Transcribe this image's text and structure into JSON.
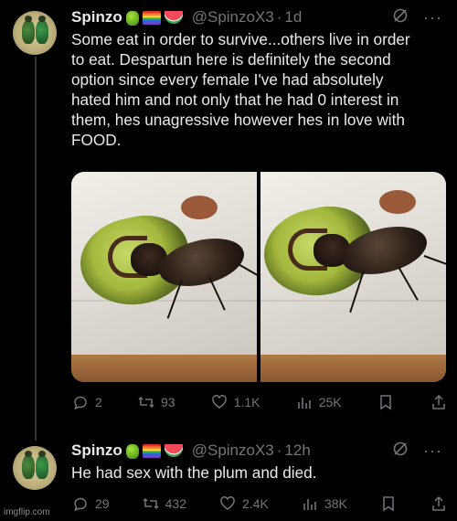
{
  "tweets": [
    {
      "name": "Spinzo",
      "emojis": [
        "beetle-emoji",
        "rainbow-flag-emoji",
        "watermelon-emoji"
      ],
      "handle": "@SpinzoX3",
      "separator": "·",
      "time": "1d",
      "text": "Some eat in order to survive...others live in order\nto eat. Despartun here is definitely the second\noption since every female I've had absolutely\nhated him and not only that he had 0 interest in\nthem, hes unagressive however hes in love with\nFOOD.",
      "stats": {
        "replies": "2",
        "reposts": "93",
        "likes": "1.1K",
        "views": "25K"
      }
    },
    {
      "name": "Spinzo",
      "emojis": [
        "beetle-emoji",
        "rainbow-flag-emoji",
        "watermelon-emoji"
      ],
      "handle": "@SpinzoX3",
      "separator": "·",
      "time": "12h",
      "text": "He had sex with the plum and died.",
      "stats": {
        "replies": "29",
        "reposts": "432",
        "likes": "2.4K",
        "views": "38K"
      }
    }
  ],
  "watermark": "imgflip.com",
  "colors": {
    "background": "#000000",
    "text": "#e7e9ea",
    "muted": "#71767b",
    "thread_line": "#333639"
  }
}
